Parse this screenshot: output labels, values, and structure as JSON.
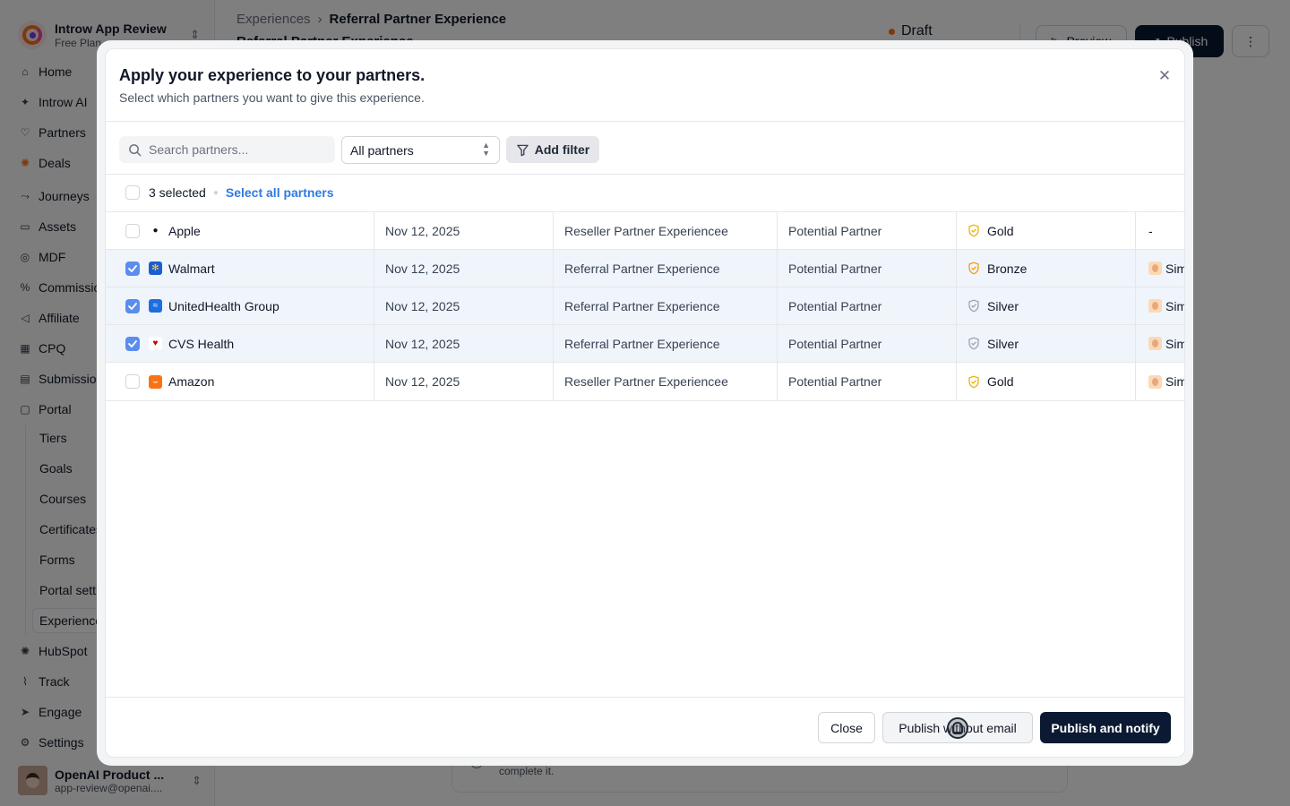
{
  "workspace": {
    "name": "Introw App Review",
    "plan": "Free Plan"
  },
  "sidebar": {
    "items": [
      {
        "label": "Home",
        "icon": "home-icon"
      },
      {
        "label": "Introw AI",
        "icon": "sparkle-icon"
      },
      {
        "label": "Partners",
        "icon": "handshake-icon"
      },
      {
        "label": "Deals",
        "icon": "hubspot-icon"
      },
      {
        "label": "Journeys",
        "icon": "route-icon"
      },
      {
        "label": "Assets",
        "icon": "folder-icon"
      },
      {
        "label": "MDF",
        "icon": "coins-icon"
      },
      {
        "label": "Commissions",
        "icon": "percent-icon"
      },
      {
        "label": "Affiliate",
        "icon": "megaphone-icon"
      },
      {
        "label": "CPQ",
        "icon": "calculator-icon"
      },
      {
        "label": "Submissions",
        "icon": "inbox-icon"
      },
      {
        "label": "Portal",
        "icon": "portal-icon"
      },
      {
        "label": "Tiers"
      },
      {
        "label": "Goals"
      },
      {
        "label": "Courses"
      },
      {
        "label": "Certificates"
      },
      {
        "label": "Forms"
      },
      {
        "label": "Portal settings"
      },
      {
        "label": "Experiences"
      },
      {
        "label": "HubSpot",
        "icon": "hubspot-icon"
      },
      {
        "label": "Track",
        "icon": "chart-icon"
      },
      {
        "label": "Engage",
        "icon": "send-icon"
      },
      {
        "label": "Settings",
        "icon": "gear-icon"
      }
    ]
  },
  "user": {
    "name": "OpenAI Product ...",
    "email": "app-review@openai...."
  },
  "header": {
    "breadcrumb_parent": "Experiences",
    "breadcrumb_current": "Referral Partner Experience",
    "title": "Referral Partner Experience",
    "status": "Draft",
    "preview_label": "Preview",
    "publish_label": "Publish"
  },
  "background_card": {
    "text": "complete it."
  },
  "modal": {
    "title": "Apply your experience to your partners.",
    "subtitle": "Select which partners you want to give this experience.",
    "search_placeholder": "Search partners...",
    "partner_filter": "All partners",
    "add_filter_label": "Add filter",
    "selected_count": "3 selected",
    "select_all_label": "Select all partners",
    "rows": [
      {
        "name": "Apple",
        "logo": "apple-logo",
        "date": "Nov 12, 2025",
        "experience": "Reseller Partner Experiencee",
        "type": "Potential Partner",
        "tier": "Gold",
        "tier_color": "#eab308",
        "owner": "-",
        "selected": false
      },
      {
        "name": "Walmart",
        "logo": "walmart-logo",
        "date": "Nov 12, 2025",
        "experience": "Referral Partner Experience",
        "type": "Potential Partner",
        "tier": "Bronze",
        "tier_color": "#f59e0b",
        "owner": "Sim",
        "selected": true
      },
      {
        "name": "UnitedHealth Group",
        "logo": "unitedhealth-logo",
        "date": "Nov 12, 2025",
        "experience": "Referral Partner Experience",
        "type": "Potential Partner",
        "tier": "Silver",
        "tier_color": "#9ca3af",
        "owner": "Sim",
        "selected": true
      },
      {
        "name": "CVS Health",
        "logo": "cvs-logo",
        "date": "Nov 12, 2025",
        "experience": "Referral Partner Experience",
        "type": "Potential Partner",
        "tier": "Silver",
        "tier_color": "#9ca3af",
        "owner": "Sim",
        "selected": true
      },
      {
        "name": "Amazon",
        "logo": "amazon-logo",
        "date": "Nov 12, 2025",
        "experience": "Reseller Partner Experiencee",
        "type": "Potential Partner",
        "tier": "Gold",
        "tier_color": "#eab308",
        "owner": "Sim",
        "selected": false
      }
    ],
    "close_label": "Close",
    "publish_without_email_label": "Publish without email",
    "publish_and_notify_label": "Publish and notify"
  },
  "colors": {
    "primary_dark": "#0b1933",
    "link_blue": "#2f7ae5",
    "checkbox_blue": "#5b8def",
    "status_orange": "#f97316"
  }
}
